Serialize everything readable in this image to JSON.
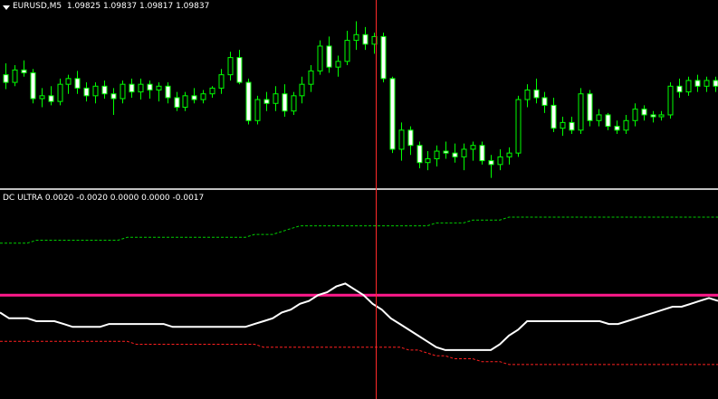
{
  "chart": {
    "symbol_label": "EURUSD,M5",
    "ohlc_label": "1.09825 1.09837 1.09817 1.09837",
    "bull_color": "#00ff00",
    "bear_color": "#00ff00",
    "bull_fill": "#000000",
    "bear_fill": "#ffffff",
    "menu_icon": "triangle-down-icon",
    "candles": [
      [
        1.0987,
        1.09882,
        1.09855,
        1.09862
      ],
      [
        1.09862,
        1.0988,
        1.09858,
        1.09875
      ],
      [
        1.09875,
        1.09885,
        1.09868,
        1.09872
      ],
      [
        1.09872,
        1.09876,
        1.0984,
        1.09845
      ],
      [
        1.09845,
        1.09856,
        1.09836,
        1.09848
      ],
      [
        1.09848,
        1.09858,
        1.09838,
        1.09842
      ],
      [
        1.09842,
        1.09866,
        1.09838,
        1.0986
      ],
      [
        1.0986,
        1.0987,
        1.0985,
        1.09866
      ],
      [
        1.09866,
        1.09874,
        1.0985,
        1.09856
      ],
      [
        1.09856,
        1.09862,
        1.09842,
        1.09848
      ],
      [
        1.09848,
        1.09862,
        1.0984,
        1.09858
      ],
      [
        1.09858,
        1.09864,
        1.09845,
        1.0985
      ],
      [
        1.0985,
        1.09856,
        1.09828,
        1.09845
      ],
      [
        1.09845,
        1.09864,
        1.0984,
        1.0986
      ],
      [
        1.0986,
        1.09866,
        1.09846,
        1.09852
      ],
      [
        1.09852,
        1.09866,
        1.09844,
        1.0986
      ],
      [
        1.0986,
        1.09864,
        1.09845,
        1.09854
      ],
      [
        1.09854,
        1.09862,
        1.09842,
        1.09858
      ],
      [
        1.09858,
        1.09862,
        1.0984,
        1.09846
      ],
      [
        1.09846,
        1.09852,
        1.09832,
        1.09836
      ],
      [
        1.09836,
        1.09852,
        1.09832,
        1.09848
      ],
      [
        1.09848,
        1.09856,
        1.0984,
        1.09844
      ],
      [
        1.09844,
        1.09854,
        1.0984,
        1.0985
      ],
      [
        1.0985,
        1.09858,
        1.09846,
        1.09856
      ],
      [
        1.09856,
        1.09876,
        1.0985,
        1.0987
      ],
      [
        1.0987,
        1.09894,
        1.09864,
        1.09888
      ],
      [
        1.09888,
        1.09896,
        1.0986,
        1.09862
      ],
      [
        1.09862,
        1.09866,
        1.09818,
        1.09822
      ],
      [
        1.09822,
        1.09848,
        1.09818,
        1.09844
      ],
      [
        1.09844,
        1.09852,
        1.09832,
        1.0984
      ],
      [
        1.0984,
        1.09858,
        1.09832,
        1.0985
      ],
      [
        1.0985,
        1.0986,
        1.09826,
        1.09832
      ],
      [
        1.09832,
        1.09852,
        1.09828,
        1.09848
      ],
      [
        1.09848,
        1.09868,
        1.0984,
        1.0986
      ],
      [
        1.0986,
        1.0988,
        1.09852,
        1.09874
      ],
      [
        1.09874,
        1.09906,
        1.0987,
        1.099
      ],
      [
        1.099,
        1.0991,
        1.09872,
        1.09878
      ],
      [
        1.09878,
        1.0989,
        1.09868,
        1.09884
      ],
      [
        1.09884,
        1.09916,
        1.0988,
        1.09906
      ],
      [
        1.09906,
        1.09926,
        1.09896,
        1.09912
      ],
      [
        1.09912,
        1.0992,
        1.09896,
        1.09902
      ],
      [
        1.09902,
        1.09914,
        1.09892,
        1.0991
      ],
      [
        1.0991,
        1.09914,
        1.09862,
        1.09866
      ],
      [
        1.09866,
        1.09868,
        1.09788,
        1.09792
      ],
      [
        1.09792,
        1.0982,
        1.0978,
        1.09812
      ],
      [
        1.09812,
        1.09816,
        1.09786,
        1.09796
      ],
      [
        1.09796,
        1.098,
        1.09772,
        1.09778
      ],
      [
        1.09778,
        1.0979,
        1.0977,
        1.09782
      ],
      [
        1.09782,
        1.09796,
        1.09774,
        1.0979
      ],
      [
        1.0979,
        1.098,
        1.09782,
        1.09788
      ],
      [
        1.09788,
        1.09798,
        1.09778,
        1.09784
      ],
      [
        1.09784,
        1.09798,
        1.0977,
        1.09792
      ],
      [
        1.09792,
        1.098,
        1.0978,
        1.09796
      ],
      [
        1.09796,
        1.098,
        1.09776,
        1.0978
      ],
      [
        1.0978,
        1.09786,
        1.09762,
        1.09776
      ],
      [
        1.09776,
        1.09792,
        1.0977,
        1.09784
      ],
      [
        1.09784,
        1.09794,
        1.09776,
        1.09788
      ],
      [
        1.09788,
        1.09848,
        1.09784,
        1.09844
      ],
      [
        1.09844,
        1.0986,
        1.09836,
        1.09854
      ],
      [
        1.09854,
        1.09866,
        1.0984,
        1.09846
      ],
      [
        1.09846,
        1.09852,
        1.0983,
        1.09838
      ],
      [
        1.09838,
        1.09846,
        1.0981,
        1.09814
      ],
      [
        1.09814,
        1.09826,
        1.09806,
        1.0982
      ],
      [
        1.0982,
        1.09826,
        1.09808,
        1.09812
      ],
      [
        1.09812,
        1.09856,
        1.09808,
        1.0985
      ],
      [
        1.0985,
        1.09854,
        1.09816,
        1.09822
      ],
      [
        1.09822,
        1.09834,
        1.09816,
        1.09828
      ],
      [
        1.09828,
        1.0983,
        1.09812,
        1.09816
      ],
      [
        1.09816,
        1.09822,
        1.09808,
        1.09812
      ],
      [
        1.09812,
        1.09828,
        1.09808,
        1.09822
      ],
      [
        1.09822,
        1.0984,
        1.09816,
        1.09834
      ],
      [
        1.09834,
        1.09838,
        1.09822,
        1.09828
      ],
      [
        1.09828,
        1.09832,
        1.0982,
        1.09826
      ],
      [
        1.09826,
        1.09832,
        1.09822,
        1.09828
      ],
      [
        1.09828,
        1.09862,
        1.09824,
        1.09858
      ],
      [
        1.09858,
        1.09866,
        1.09846,
        1.09852
      ],
      [
        1.09852,
        1.09868,
        1.09848,
        1.09864
      ],
      [
        1.09864,
        1.0987,
        1.09852,
        1.09858
      ],
      [
        1.09858,
        1.09868,
        1.09852,
        1.09864
      ],
      [
        1.09864,
        1.09868,
        1.09852,
        1.09858
      ]
    ],
    "price_range": [
      1.09755,
      1.09935
    ]
  },
  "indicator": {
    "name": "DC ULTRA",
    "values_label": "0.0020 -0.0020 0.0000 0.0000 -0.0017",
    "upper_color": "#00cc00",
    "lower_color": "#ff2020",
    "main_color": "#ffffff",
    "level_color": "#ff1a8c",
    "level_value": 0.0,
    "range": [
      -0.0035,
      0.0032
    ],
    "upper": [
      0.0018,
      0.0018,
      0.0018,
      0.0018,
      0.0019,
      0.0019,
      0.0019,
      0.0019,
      0.0019,
      0.0019,
      0.0019,
      0.0019,
      0.0019,
      0.0019,
      0.002,
      0.002,
      0.002,
      0.002,
      0.002,
      0.002,
      0.002,
      0.002,
      0.002,
      0.002,
      0.002,
      0.002,
      0.002,
      0.002,
      0.0021,
      0.0021,
      0.0021,
      0.0022,
      0.0023,
      0.0024,
      0.0024,
      0.0024,
      0.0024,
      0.0024,
      0.0024,
      0.0024,
      0.0024,
      0.0024,
      0.0024,
      0.0024,
      0.0024,
      0.0024,
      0.0024,
      0.0024,
      0.0025,
      0.0025,
      0.0025,
      0.0025,
      0.0026,
      0.0026,
      0.0026,
      0.0026,
      0.0027,
      0.0027,
      0.0027,
      0.0027,
      0.0027,
      0.0027,
      0.0027,
      0.0027,
      0.0027,
      0.0027,
      0.0027,
      0.0027,
      0.0027,
      0.0027,
      0.0027,
      0.0027,
      0.0027,
      0.0027,
      0.0027,
      0.0027,
      0.0027,
      0.0027,
      0.0027,
      0.0027
    ],
    "lower": [
      -0.0016,
      -0.0016,
      -0.0016,
      -0.0016,
      -0.0016,
      -0.0016,
      -0.0016,
      -0.0016,
      -0.0016,
      -0.0016,
      -0.0016,
      -0.0016,
      -0.0016,
      -0.0016,
      -0.0016,
      -0.0017,
      -0.0017,
      -0.0017,
      -0.0017,
      -0.0017,
      -0.0017,
      -0.0017,
      -0.0017,
      -0.0017,
      -0.0017,
      -0.0017,
      -0.0017,
      -0.0017,
      -0.0017,
      -0.0018,
      -0.0018,
      -0.0018,
      -0.0018,
      -0.0018,
      -0.0018,
      -0.0018,
      -0.0018,
      -0.0018,
      -0.0018,
      -0.0018,
      -0.0018,
      -0.0018,
      -0.0018,
      -0.0018,
      -0.0018,
      -0.0019,
      -0.0019,
      -0.002,
      -0.0021,
      -0.0021,
      -0.0022,
      -0.0022,
      -0.0022,
      -0.0023,
      -0.0023,
      -0.0023,
      -0.0024,
      -0.0024,
      -0.0024,
      -0.0024,
      -0.0024,
      -0.0024,
      -0.0024,
      -0.0024,
      -0.0024,
      -0.0024,
      -0.0024,
      -0.0024,
      -0.0024,
      -0.0024,
      -0.0024,
      -0.0024,
      -0.0024,
      -0.0024,
      -0.0024,
      -0.0024,
      -0.0024,
      -0.0024,
      -0.0024,
      -0.0024
    ],
    "main": [
      -0.0006,
      -0.0008,
      -0.0008,
      -0.0008,
      -0.0009,
      -0.0009,
      -0.0009,
      -0.001,
      -0.0011,
      -0.0011,
      -0.0011,
      -0.0011,
      -0.001,
      -0.001,
      -0.001,
      -0.001,
      -0.001,
      -0.001,
      -0.001,
      -0.0011,
      -0.0011,
      -0.0011,
      -0.0011,
      -0.0011,
      -0.0011,
      -0.0011,
      -0.0011,
      -0.0011,
      -0.001,
      -0.0009,
      -0.0008,
      -0.0006,
      -0.0005,
      -0.0003,
      -0.0002,
      0.0,
      0.0001,
      0.0003,
      0.0004,
      0.0002,
      0.0,
      -0.0003,
      -0.0005,
      -0.0008,
      -0.001,
      -0.0012,
      -0.0014,
      -0.0016,
      -0.0018,
      -0.0019,
      -0.0019,
      -0.0019,
      -0.0019,
      -0.0019,
      -0.0019,
      -0.0017,
      -0.0014,
      -0.0012,
      -0.0009,
      -0.0009,
      -0.0009,
      -0.0009,
      -0.0009,
      -0.0009,
      -0.0009,
      -0.0009,
      -0.0009,
      -0.001,
      -0.001,
      -0.0009,
      -0.0008,
      -0.0007,
      -0.0006,
      -0.0005,
      -0.0004,
      -0.0004,
      -0.0003,
      -0.0002,
      -0.0001,
      -0.0002
    ]
  }
}
